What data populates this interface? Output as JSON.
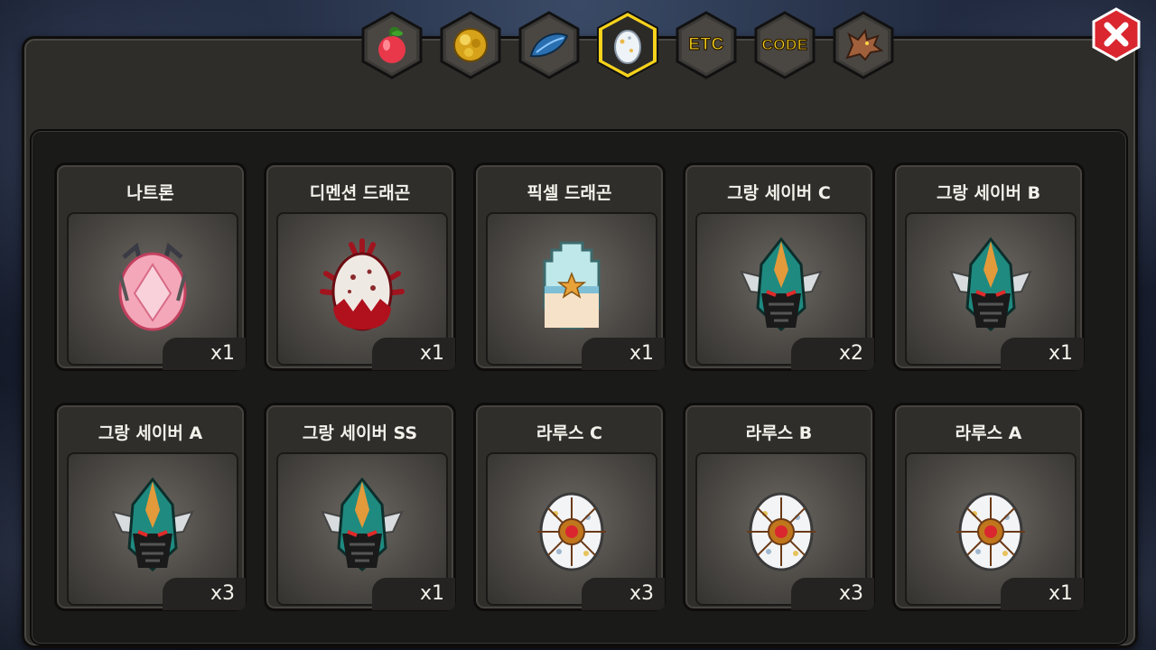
{
  "tabs": [
    {
      "id": "fruit",
      "icon": "fruit-icon",
      "label": ""
    },
    {
      "id": "gold",
      "icon": "gold-orb-icon",
      "label": ""
    },
    {
      "id": "feather",
      "icon": "blue-feather-icon",
      "label": ""
    },
    {
      "id": "egg",
      "icon": "egg-icon",
      "label": "",
      "active": true
    },
    {
      "id": "etc",
      "icon": "",
      "label": "ETC"
    },
    {
      "id": "code",
      "icon": "",
      "label": "CODE"
    },
    {
      "id": "dragon",
      "icon": "dragon-head-icon",
      "label": ""
    }
  ],
  "items": [
    {
      "name": "나트론",
      "count": "x1",
      "icon": "pink-egg"
    },
    {
      "name": "디멘션 드래곤",
      "count": "x1",
      "icon": "spiked-red-egg"
    },
    {
      "name": "픽셀 드래곤",
      "count": "x1",
      "icon": "pixel-egg"
    },
    {
      "name": "그랑 세이버 C",
      "count": "x2",
      "icon": "saber-helmet"
    },
    {
      "name": "그랑 세이버 B",
      "count": "x1",
      "icon": "saber-helmet"
    },
    {
      "name": "그랑 세이버 A",
      "count": "x3",
      "icon": "saber-helmet"
    },
    {
      "name": "그랑 세이버 SS",
      "count": "x1",
      "icon": "saber-helmet"
    },
    {
      "name": "라루스 C",
      "count": "x3",
      "icon": "larus-egg"
    },
    {
      "name": "라루스 B",
      "count": "x3",
      "icon": "larus-egg"
    },
    {
      "name": "라루스 A",
      "count": "x1",
      "icon": "larus-egg"
    }
  ],
  "colors": {
    "accent": "#f7d21c",
    "close": "#d9262f",
    "panel": "#2e2d2a"
  }
}
